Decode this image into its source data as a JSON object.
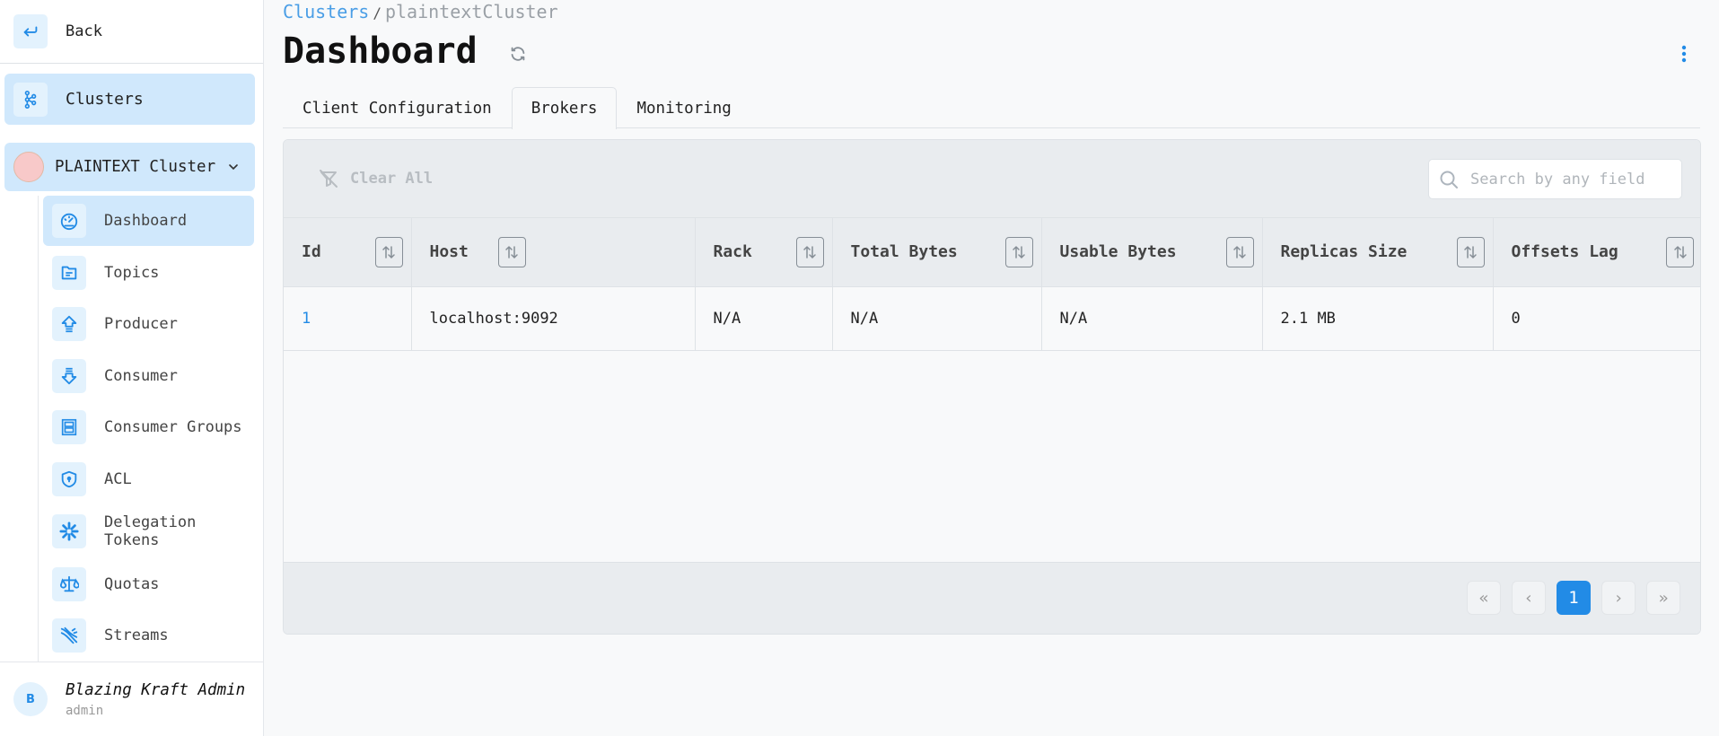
{
  "sidebar": {
    "back_label": "Back",
    "clusters_label": "Clusters",
    "cluster_name": "PLAINTEXT Cluster",
    "cluster_color": "#f8c9c9",
    "items": [
      {
        "label": "Dashboard",
        "icon": "dashboard-gauge-icon",
        "active": true
      },
      {
        "label": "Topics",
        "icon": "folder-icon",
        "active": false
      },
      {
        "label": "Producer",
        "icon": "arrow-up-icon",
        "active": false
      },
      {
        "label": "Consumer",
        "icon": "arrow-down-icon",
        "active": false
      },
      {
        "label": "Consumer Groups",
        "icon": "group-frame-icon",
        "active": false
      },
      {
        "label": "ACL",
        "icon": "shield-lock-icon",
        "active": false
      },
      {
        "label": "Delegation Tokens",
        "icon": "asterisk-icon",
        "active": false
      },
      {
        "label": "Quotas",
        "icon": "scale-icon",
        "active": false
      },
      {
        "label": "Streams",
        "icon": "streams-icon",
        "active": false
      }
    ],
    "user": {
      "initial": "B",
      "name": "Blazing Kraft Admin",
      "role": "admin"
    }
  },
  "header": {
    "breadcrumb": {
      "link": "Clusters",
      "separator": "/",
      "current": "plaintextCluster"
    },
    "title": "Dashboard"
  },
  "tabs": [
    {
      "label": "Client Configuration",
      "active": false
    },
    {
      "label": "Brokers",
      "active": true
    },
    {
      "label": "Monitoring",
      "active": false
    }
  ],
  "toolbar": {
    "clear_all_label": "Clear All",
    "search_placeholder": "Search by any field",
    "search_value": ""
  },
  "table": {
    "columns": [
      "Id",
      "Host",
      "Rack",
      "Total Bytes",
      "Usable Bytes",
      "Replicas Size",
      "Offsets Lag"
    ],
    "rows": [
      [
        "1",
        "localhost:9092",
        "N/A",
        "N/A",
        "N/A",
        "2.1 MB",
        "0"
      ]
    ]
  },
  "pagination": {
    "first": "«",
    "prev": "‹",
    "current_page": "1",
    "next": "›",
    "last": "»"
  },
  "colors": {
    "accent": "#228be6",
    "active_bg": "#d0e8fc",
    "icon_bg": "#e3f2fd"
  }
}
